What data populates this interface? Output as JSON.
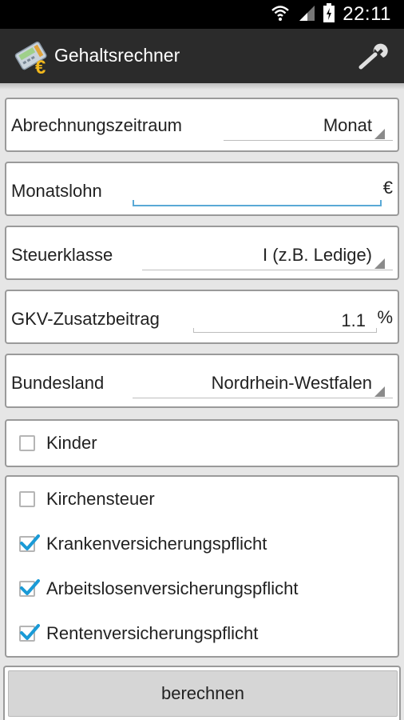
{
  "status_bar": {
    "time": "22:11",
    "icons": [
      "wifi-icon",
      "signal-icon",
      "battery-icon"
    ]
  },
  "app_bar": {
    "title": "Gehaltsrechner",
    "app_icon": "calculator-euro-icon",
    "action_icon": "wrench-icon"
  },
  "form": {
    "period": {
      "label": "Abrechnungszeitraum",
      "value": "Monat"
    },
    "salary": {
      "label": "Monatslohn",
      "value": "",
      "unit": "€"
    },
    "tax_class": {
      "label": "Steuerklasse",
      "value": "I (z.B. Ledige)"
    },
    "gkv": {
      "label": "GKV-Zusatzbeitrag",
      "value": "1.1",
      "unit": "%"
    },
    "state": {
      "label": "Bundesland",
      "value": "Nordrhein-Westfalen"
    },
    "children": {
      "label": "Kinder",
      "checked": false
    },
    "options": [
      {
        "label": "Kirchensteuer",
        "checked": false
      },
      {
        "label": "Krankenversicherungspflicht",
        "checked": true
      },
      {
        "label": "Arbeitslosenversicherungspflicht",
        "checked": true
      },
      {
        "label": "Rentenversicherungspflicht",
        "checked": true
      }
    ]
  },
  "actions": {
    "calculate_label": "berechnen"
  },
  "colors": {
    "accent": "#33b5e5",
    "check": "#1a9ad6",
    "action_bar": "#2b2b2b"
  }
}
